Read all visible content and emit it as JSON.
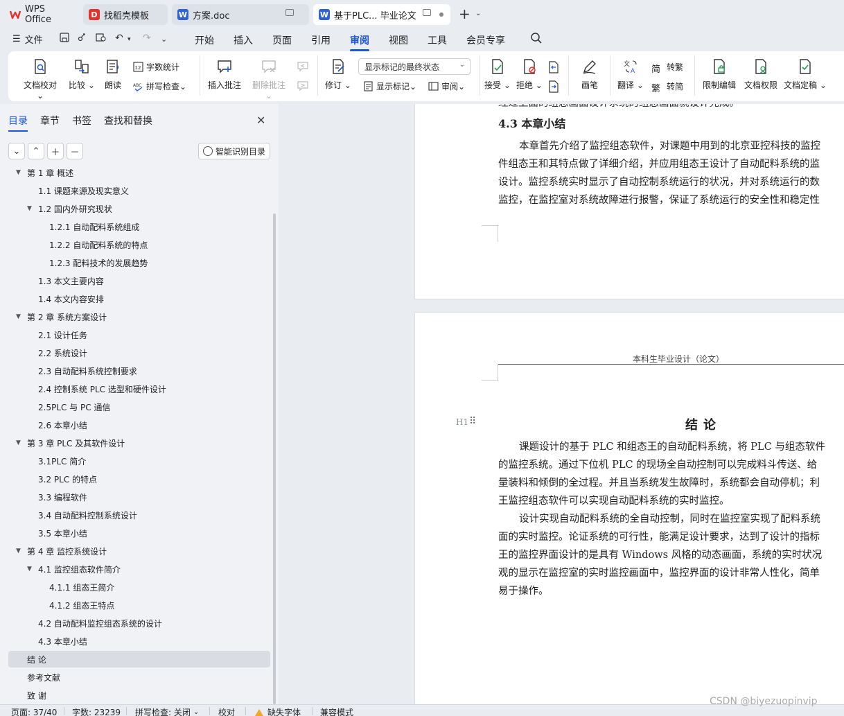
{
  "tabs": {
    "wps": "WPS Office",
    "templates": "找稻壳模板",
    "fangan": "方案.doc",
    "thesis": "基于PLC... 毕业论文"
  },
  "menu": {
    "file": "文件",
    "tabs": [
      "开始",
      "插入",
      "页面",
      "引用",
      "审阅",
      "视图",
      "工具",
      "会员专享"
    ],
    "active_tab": "审阅"
  },
  "ribbon": {
    "doc_check": "文档校对",
    "compare": "比较",
    "read_aloud": "朗读",
    "word_count": "字数统计",
    "spell_check": "拼写检查",
    "insert_comment": "插入批注",
    "delete_comment": "删除批注",
    "revise": "修订",
    "markup_mode": "显示标记的最终状态",
    "show_markup": "显示标记",
    "review": "审阅",
    "accept": "接受",
    "reject": "拒绝",
    "pen": "画笔",
    "translate": "翻译",
    "to_traditional": "转繁",
    "to_simplified": "转简",
    "restrict_edit": "限制编辑",
    "doc_permission": "文档权限",
    "finalize": "文档定稿"
  },
  "sidebar": {
    "tabs": [
      "目录",
      "章节",
      "书签",
      "查找和替换"
    ],
    "smart_toc": "智能识别目录",
    "toc": [
      {
        "label": "第 1 章   概述",
        "level": 1,
        "caret": true,
        "clipped": true
      },
      {
        "label": "1.1 课题来源及现实意义",
        "level": 2
      },
      {
        "label": "1.2 国内外研究现状",
        "level": 2,
        "caret": true
      },
      {
        "label": "1.2.1 自动配料系统组成",
        "level": 3
      },
      {
        "label": "1.2.2 自动配料系统的特点",
        "level": 3
      },
      {
        "label": "1.2.3 配料技术的发展趋势",
        "level": 3
      },
      {
        "label": "1.3 本文主要内容",
        "level": 2
      },
      {
        "label": "1.4 本文内容安排",
        "level": 2
      },
      {
        "label": "第 2 章   系统方案设计",
        "level": 1,
        "caret": true
      },
      {
        "label": "2.1 设计任务",
        "level": 2
      },
      {
        "label": "2.2 系统设计",
        "level": 2
      },
      {
        "label": "2.3 自动配料系统控制要求",
        "level": 2
      },
      {
        "label": "2.4 控制系统 PLC 选型和硬件设计",
        "level": 2
      },
      {
        "label": "2.5PLC 与 PC 通信",
        "level": 2
      },
      {
        "label": "2.6 本章小结",
        "level": 2
      },
      {
        "label": "第 3 章   PLC 及其软件设计",
        "level": 1,
        "caret": true
      },
      {
        "label": "3.1PLC 简介",
        "level": 2
      },
      {
        "label": "3.2 PLC 的特点",
        "level": 2
      },
      {
        "label": "3.3   编程软件",
        "level": 2
      },
      {
        "label": "3.4 自动配料控制系统设计",
        "level": 2
      },
      {
        "label": "3.5 本章小结",
        "level": 2
      },
      {
        "label": "第 4 章   监控系统设计",
        "level": 1,
        "caret": true
      },
      {
        "label": "4.1   监控组态软件简介",
        "level": 2,
        "caret": true
      },
      {
        "label": "4.1.1   组态王简介",
        "level": 3
      },
      {
        "label": "4.1.2 组态王特点",
        "level": 3
      },
      {
        "label": "4.2   自动配料监控组态系统的设计",
        "level": 2
      },
      {
        "label": "4.3 本章小结",
        "level": 2
      },
      {
        "label": "结   论",
        "level": 1,
        "selected": true
      },
      {
        "label": "参考文献",
        "level": 1
      },
      {
        "label": "致   谢",
        "level": 1
      }
    ]
  },
  "document": {
    "page1": {
      "top_line": "经过上面的组态画面设计系统的组态画面就设计完成。",
      "heading": "4.3 本章小结",
      "lines": [
        "本章首先介绍了监控组态软件，对课题中用到的北京亚控科技的监控",
        "件组态王和其特点做了详细介绍，并应用组态王设计了自动配料系统的监",
        "设计。监控系统实时显示了自动控制系统运行的状况，并对系统运行的数",
        "监控，在监控室对系统故障进行报警，保证了系统运行的安全性和稳定性"
      ]
    },
    "page2": {
      "header": "本科生毕业设计（论文）",
      "heading_mark": "H1",
      "title": "结论",
      "lines": [
        "课题设计的基于 PLC 和组态王的自动配料系统，将 PLC 与组态软件",
        "的监控系统。通过下位机 PLC 的现场全自动控制可以完成料斗传送、给",
        "量装料和倾倒的全过程。并且当系统发生故障时，系统都会自动停机；利",
        "王监控组态软件可以实现自动配料系统的实时监控。",
        "设计实现自动配料系统的全自动控制，同时在监控室实现了配料系统",
        "面的实时监控。论证系统的可行性，能满足设计要求，达到了设计的指标",
        "王的监控界面设计的是具有 Windows 风格的动态画面，系统的实时状况",
        "观的显示在监控室的实时监控画面中，监控界面的设计非常人性化，简单",
        "易于操作。"
      ]
    }
  },
  "statusbar": {
    "page": "页面: 37/40",
    "words": "字数: 23239",
    "spell": "拼写检查: 关闭",
    "proof": "校对",
    "missing_font": "缺失字体",
    "compat": "兼容模式"
  },
  "watermark": "CSDN @biyezuopinvip",
  "colors": {
    "accent": "#1a56d6",
    "wps_red": "#e5312b",
    "word_blue": "#2e62d9"
  }
}
